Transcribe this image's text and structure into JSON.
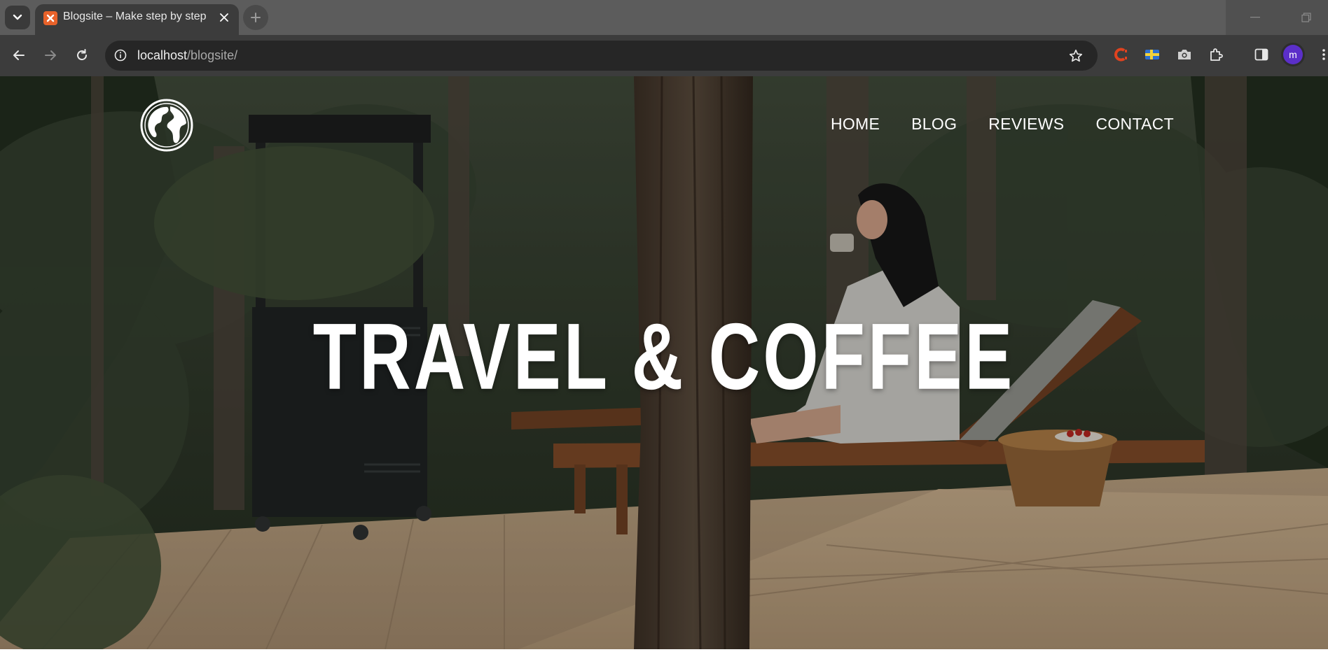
{
  "browser": {
    "tab": {
      "title": "Blogsite – Make step by step",
      "favicon": "xampp-icon"
    },
    "address_bar": {
      "host": "localhost",
      "path": "/blogsite/"
    },
    "profile_initial": "m",
    "icons": {
      "tab_menu": "chevron-down-icon",
      "close_tab": "close-icon",
      "new_tab": "plus-icon",
      "back": "arrow-left-icon",
      "forward": "arrow-right-icon",
      "reload": "reload-icon",
      "site_info": "info-icon",
      "bookmark": "star-icon",
      "extensions": [
        "c-extension-icon",
        "flag-extension-icon",
        "camera-extension-icon",
        "puzzle-icon"
      ],
      "side_panel": "side-panel-icon",
      "menu": "kebab-menu-icon"
    }
  },
  "site": {
    "logo": "globe-icon",
    "nav": {
      "home": "HOME",
      "blog": "BLOG",
      "reviews": "REVIEWS",
      "contact": "CONTACT"
    },
    "hero": {
      "title": "TRAVEL & COFFEE"
    }
  },
  "colors": {
    "chrome_tabbar": "#5c5c5c",
    "chrome_toolbar": "#3c3c3c",
    "omnibox": "#262626",
    "avatar": "#5b2fc9",
    "favicon": "#e8622a",
    "nav_text": "#ffffff"
  }
}
